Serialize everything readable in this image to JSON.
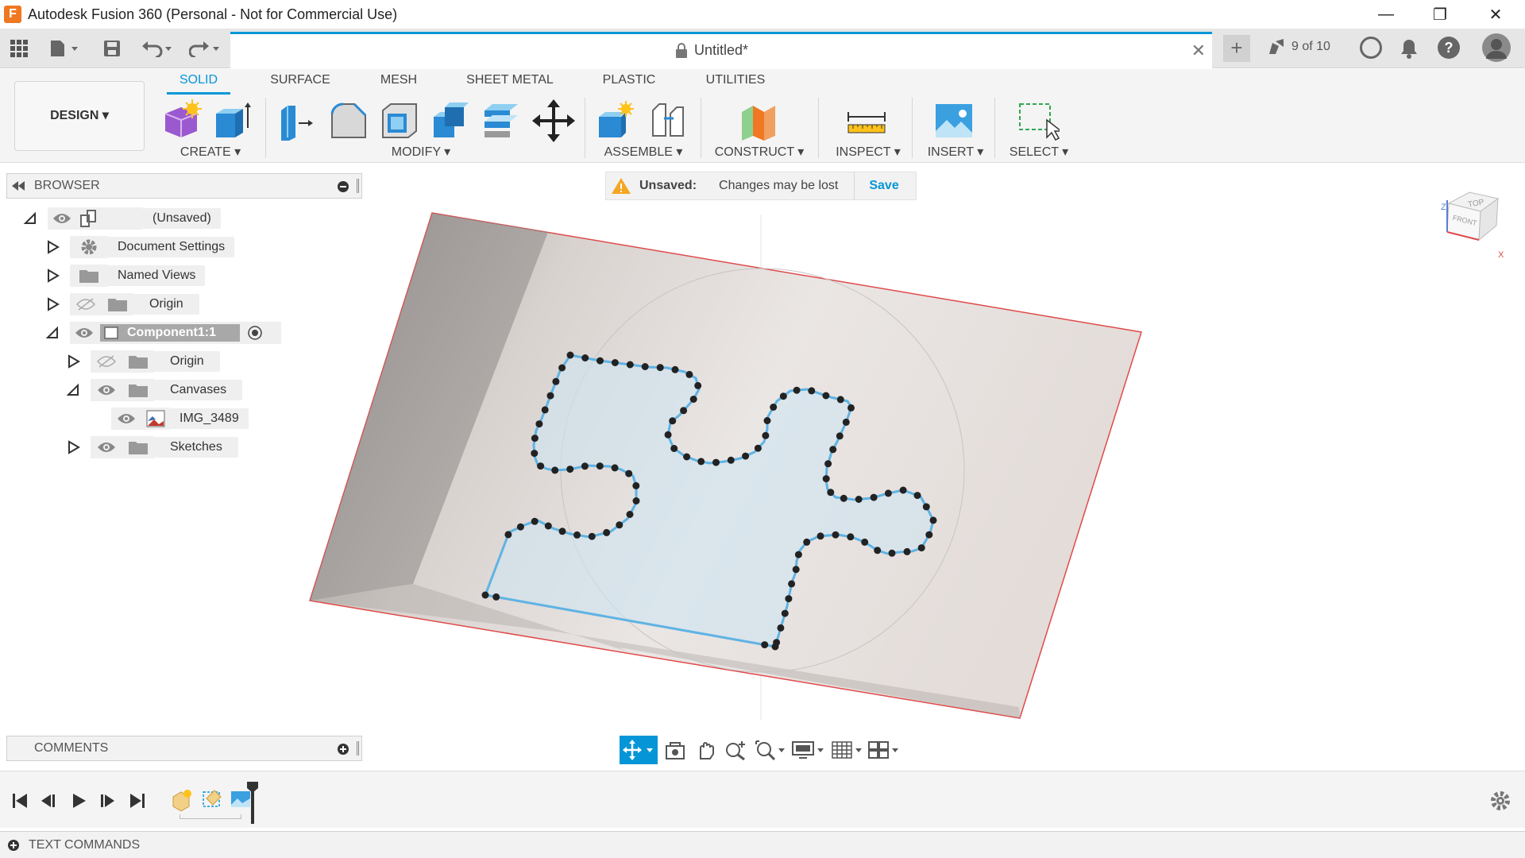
{
  "window": {
    "title": "Autodesk Fusion 360 (Personal - Not for Commercial Use)",
    "logo_letter": "F",
    "minimize": "—",
    "restore": "❐",
    "close": "✕"
  },
  "appbar": {
    "document_title": "Untitled*",
    "doc_close": "✕",
    "new_tab": "+",
    "versions": "9 of 10"
  },
  "ribbon": {
    "workspace": "DESIGN ▾",
    "tabs": [
      "SOLID",
      "SURFACE",
      "MESH",
      "SHEET METAL",
      "PLASTIC",
      "UTILITIES"
    ],
    "active_tab": "SOLID",
    "groups": [
      "CREATE ▾",
      "MODIFY ▾",
      "ASSEMBLE ▾",
      "CONSTRUCT ▾",
      "INSPECT ▾",
      "INSERT ▾",
      "SELECT ▾"
    ]
  },
  "browser": {
    "title": "BROWSER",
    "items": [
      {
        "label": "(Unsaved)"
      },
      {
        "label": "Document Settings"
      },
      {
        "label": "Named Views"
      },
      {
        "label": "Origin"
      },
      {
        "label": "Component1:1"
      },
      {
        "label": "Origin"
      },
      {
        "label": "Canvases"
      },
      {
        "label": "IMG_3489"
      },
      {
        "label": "Sketches"
      }
    ]
  },
  "notice": {
    "status": "Unsaved:",
    "message": "Changes may be lost",
    "action": "Save"
  },
  "viewcube": {
    "top": "TOP",
    "front": "FRONT",
    "axis_z": "Z",
    "axis_x": "X"
  },
  "comments": {
    "title": "COMMENTS"
  },
  "text_commands": {
    "title": "TEXT COMMANDS"
  },
  "colors": {
    "accent": "#0696d7",
    "warning": "#f5a623",
    "sketch_line": "#5fb3e3",
    "canvas_border": "#e04a4a"
  }
}
